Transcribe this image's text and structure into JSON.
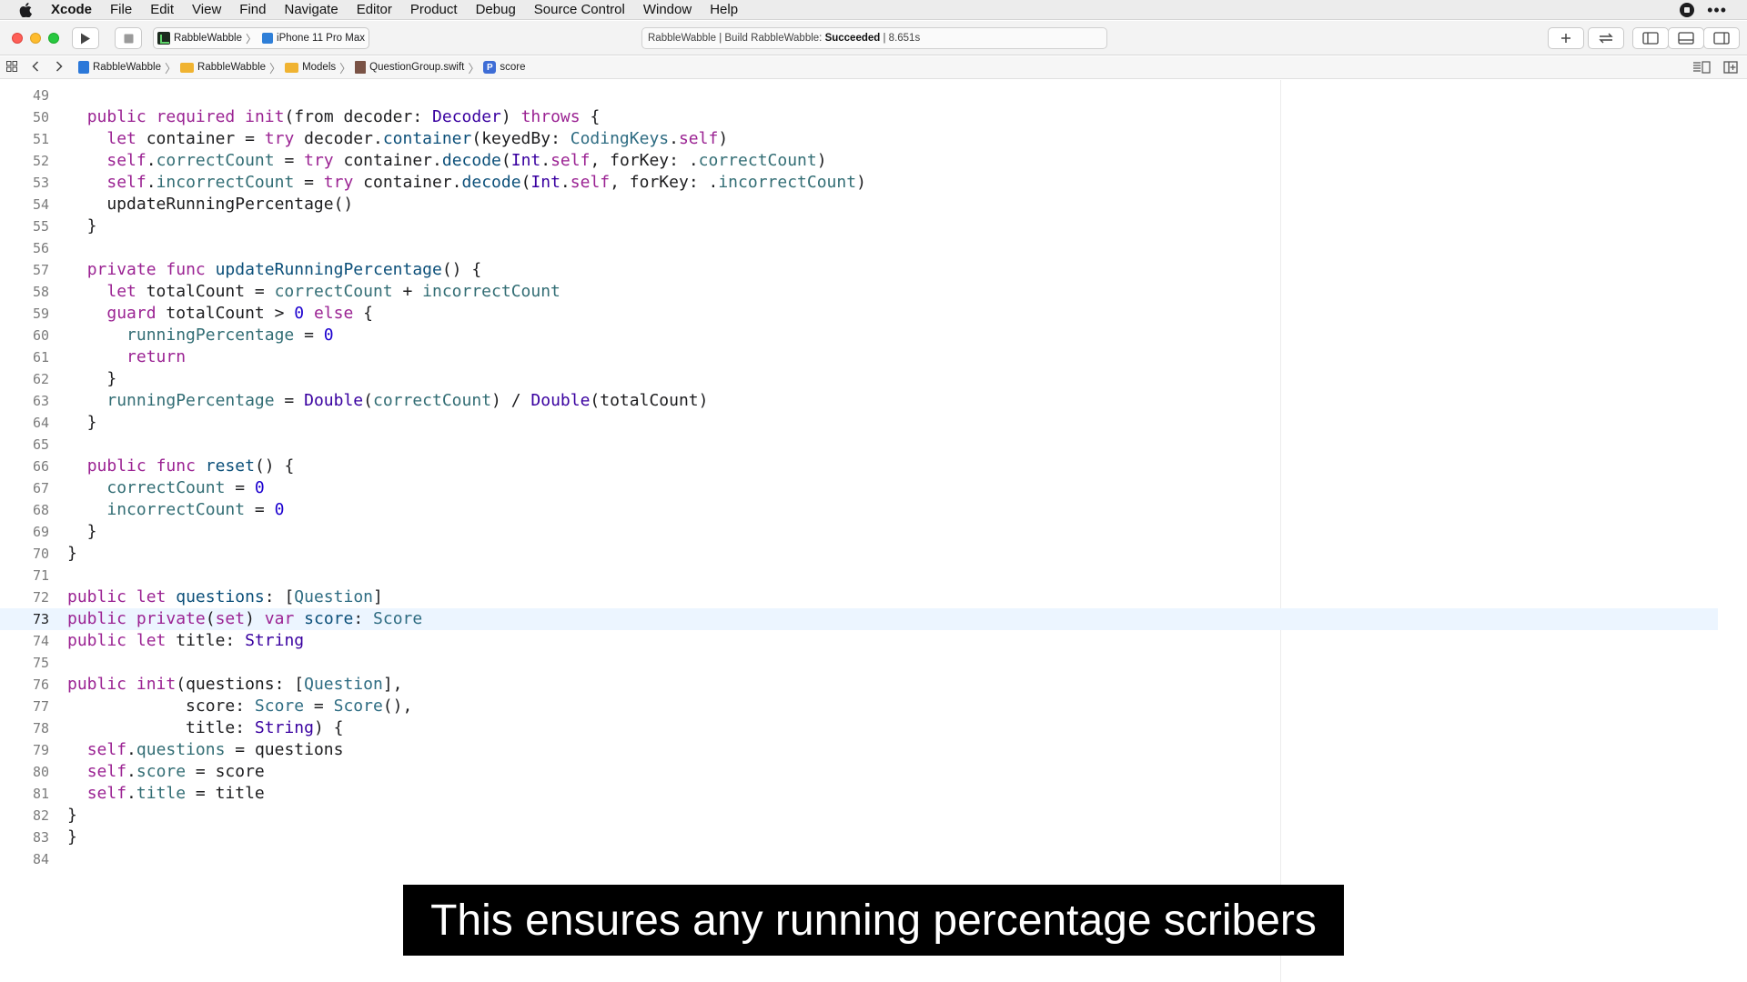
{
  "menubar": {
    "app": "Xcode",
    "items": [
      "File",
      "Edit",
      "View",
      "Find",
      "Navigate",
      "Editor",
      "Product",
      "Debug",
      "Source Control",
      "Window",
      "Help"
    ],
    "more": "•••"
  },
  "toolbar": {
    "scheme": "RabbleWabble",
    "destination": "iPhone 11 Pro Max",
    "activity_prefix": "RabbleWabble | Build RabbleWabble: ",
    "activity_status": "Succeeded",
    "activity_time": " | 8.651s"
  },
  "jumpbar": {
    "crumbs": [
      "RabbleWabble",
      "RabbleWabble",
      "Models",
      "QuestionGroup.swift",
      "score"
    ],
    "symbol_badge": "P"
  },
  "editor": {
    "current_line": "73",
    "lines": [
      {
        "n": "49",
        "tokens": []
      },
      {
        "n": "50",
        "tokens": [
          [
            "  ",
            ""
          ],
          [
            "public",
            "kw"
          ],
          [
            " ",
            ""
          ],
          [
            "required",
            "kw"
          ],
          [
            " ",
            ""
          ],
          [
            "init",
            "kw"
          ],
          [
            "(from decoder: ",
            ""
          ],
          [
            "Decoder",
            "ty"
          ],
          [
            ") ",
            ""
          ],
          [
            "throws",
            "kw"
          ],
          [
            " {",
            ""
          ]
        ]
      },
      {
        "n": "51",
        "tokens": [
          [
            "    ",
            ""
          ],
          [
            "let",
            "kw"
          ],
          [
            " container = ",
            ""
          ],
          [
            "try",
            "kw"
          ],
          [
            " decoder.",
            ""
          ],
          [
            "container",
            "cl"
          ],
          [
            "(keyedBy: ",
            ""
          ],
          [
            "CodingKeys",
            "tp"
          ],
          [
            ".",
            ""
          ],
          [
            "self",
            "kw"
          ],
          [
            ")",
            ""
          ]
        ]
      },
      {
        "n": "52",
        "tokens": [
          [
            "    ",
            ""
          ],
          [
            "self",
            "kw"
          ],
          [
            ".",
            ""
          ],
          [
            "correctCount",
            "pr"
          ],
          [
            " = ",
            ""
          ],
          [
            "try",
            "kw"
          ],
          [
            " container.",
            ""
          ],
          [
            "decode",
            "cl"
          ],
          [
            "(",
            ""
          ],
          [
            "Int",
            "ty"
          ],
          [
            ".",
            ""
          ],
          [
            "self",
            "kw"
          ],
          [
            ", forKey: .",
            ""
          ],
          [
            "correctCount",
            "pr"
          ],
          [
            ")",
            ""
          ]
        ]
      },
      {
        "n": "53",
        "tokens": [
          [
            "    ",
            ""
          ],
          [
            "self",
            "kw"
          ],
          [
            ".",
            ""
          ],
          [
            "incorrectCount",
            "pr"
          ],
          [
            " = ",
            ""
          ],
          [
            "try",
            "kw"
          ],
          [
            " container.",
            ""
          ],
          [
            "decode",
            "cl"
          ],
          [
            "(",
            ""
          ],
          [
            "Int",
            "ty"
          ],
          [
            ".",
            ""
          ],
          [
            "self",
            "kw"
          ],
          [
            ", forKey: .",
            ""
          ],
          [
            "incorrectCount",
            "pr"
          ],
          [
            ")",
            ""
          ]
        ]
      },
      {
        "n": "54",
        "tokens": [
          [
            "    updateRunningPercentage()",
            ""
          ]
        ]
      },
      {
        "n": "55",
        "tokens": [
          [
            "  }",
            ""
          ]
        ]
      },
      {
        "n": "56",
        "tokens": []
      },
      {
        "n": "57",
        "tokens": [
          [
            "  ",
            ""
          ],
          [
            "private",
            "kw"
          ],
          [
            " ",
            ""
          ],
          [
            "func",
            "kw"
          ],
          [
            " ",
            ""
          ],
          [
            "updateRunningPercentage",
            "cl"
          ],
          [
            "() {",
            ""
          ]
        ]
      },
      {
        "n": "58",
        "tokens": [
          [
            "    ",
            ""
          ],
          [
            "let",
            "kw"
          ],
          [
            " totalCount = ",
            ""
          ],
          [
            "correctCount",
            "pr"
          ],
          [
            " + ",
            ""
          ],
          [
            "incorrectCount",
            "pr"
          ]
        ]
      },
      {
        "n": "59",
        "tokens": [
          [
            "    ",
            ""
          ],
          [
            "guard",
            "kw"
          ],
          [
            " totalCount > ",
            ""
          ],
          [
            "0",
            "nu"
          ],
          [
            " ",
            ""
          ],
          [
            "else",
            "kw"
          ],
          [
            " {",
            ""
          ]
        ]
      },
      {
        "n": "60",
        "tokens": [
          [
            "      ",
            ""
          ],
          [
            "runningPercentage",
            "pr"
          ],
          [
            " = ",
            ""
          ],
          [
            "0",
            "nu"
          ]
        ]
      },
      {
        "n": "61",
        "tokens": [
          [
            "      ",
            ""
          ],
          [
            "return",
            "kw"
          ]
        ]
      },
      {
        "n": "62",
        "tokens": [
          [
            "    }",
            ""
          ]
        ]
      },
      {
        "n": "63",
        "tokens": [
          [
            "    ",
            ""
          ],
          [
            "runningPercentage",
            "pr"
          ],
          [
            " = ",
            ""
          ],
          [
            "Double",
            "ty"
          ],
          [
            "(",
            ""
          ],
          [
            "correctCount",
            "pr"
          ],
          [
            ") / ",
            ""
          ],
          [
            "Double",
            "ty"
          ],
          [
            "(totalCount)",
            ""
          ]
        ]
      },
      {
        "n": "64",
        "tokens": [
          [
            "  }",
            ""
          ]
        ]
      },
      {
        "n": "65",
        "tokens": []
      },
      {
        "n": "66",
        "tokens": [
          [
            "  ",
            ""
          ],
          [
            "public",
            "kw"
          ],
          [
            " ",
            ""
          ],
          [
            "func",
            "kw"
          ],
          [
            " ",
            ""
          ],
          [
            "reset",
            "cl"
          ],
          [
            "() {",
            ""
          ]
        ]
      },
      {
        "n": "67",
        "tokens": [
          [
            "    ",
            ""
          ],
          [
            "correctCount",
            "pr"
          ],
          [
            " = ",
            ""
          ],
          [
            "0",
            "nu"
          ]
        ]
      },
      {
        "n": "68",
        "tokens": [
          [
            "    ",
            ""
          ],
          [
            "incorrectCount",
            "pr"
          ],
          [
            " = ",
            ""
          ],
          [
            "0",
            "nu"
          ]
        ]
      },
      {
        "n": "69",
        "tokens": [
          [
            "  }",
            ""
          ]
        ]
      },
      {
        "n": "70",
        "tokens": [
          [
            "}",
            ""
          ]
        ]
      },
      {
        "n": "71",
        "tokens": []
      },
      {
        "n": "72",
        "tokens": [
          [
            "public",
            "kw"
          ],
          [
            " ",
            ""
          ],
          [
            "let",
            "kw"
          ],
          [
            " ",
            ""
          ],
          [
            "questions",
            "cl"
          ],
          [
            ": [",
            ""
          ],
          [
            "Question",
            "tp"
          ],
          [
            "]",
            ""
          ]
        ]
      },
      {
        "n": "73",
        "tokens": [
          [
            "public",
            "kw"
          ],
          [
            " ",
            ""
          ],
          [
            "private",
            "kw"
          ],
          [
            "(",
            ""
          ],
          [
            "set",
            "kw"
          ],
          [
            ") ",
            ""
          ],
          [
            "var",
            "kw"
          ],
          [
            " ",
            ""
          ],
          [
            "score",
            "cl"
          ],
          [
            ": ",
            ""
          ],
          [
            "Score",
            "tp"
          ]
        ]
      },
      {
        "n": "74",
        "tokens": [
          [
            "public",
            "kw"
          ],
          [
            " ",
            ""
          ],
          [
            "let",
            "kw"
          ],
          [
            " title: ",
            ""
          ],
          [
            "String",
            "ty"
          ]
        ]
      },
      {
        "n": "75",
        "tokens": []
      },
      {
        "n": "76",
        "tokens": [
          [
            "public",
            "kw"
          ],
          [
            " ",
            ""
          ],
          [
            "init",
            "kw"
          ],
          [
            "(questions: [",
            ""
          ],
          [
            "Question",
            "tp"
          ],
          [
            "],",
            ""
          ]
        ]
      },
      {
        "n": "77",
        "tokens": [
          [
            "            score: ",
            ""
          ],
          [
            "Score",
            "tp"
          ],
          [
            " = ",
            ""
          ],
          [
            "Score",
            "tp"
          ],
          [
            "(),",
            ""
          ]
        ]
      },
      {
        "n": "78",
        "tokens": [
          [
            "            title: ",
            ""
          ],
          [
            "String",
            "ty"
          ],
          [
            ") {",
            ""
          ]
        ]
      },
      {
        "n": "79",
        "tokens": [
          [
            "  ",
            ""
          ],
          [
            "self",
            "kw"
          ],
          [
            ".",
            ""
          ],
          [
            "questions",
            "pr"
          ],
          [
            " = questions",
            ""
          ]
        ]
      },
      {
        "n": "80",
        "tokens": [
          [
            "  ",
            ""
          ],
          [
            "self",
            "kw"
          ],
          [
            ".",
            ""
          ],
          [
            "score",
            "pr"
          ],
          [
            " = score",
            ""
          ]
        ]
      },
      {
        "n": "81",
        "tokens": [
          [
            "  ",
            ""
          ],
          [
            "self",
            "kw"
          ],
          [
            ".",
            ""
          ],
          [
            "title",
            "pr"
          ],
          [
            " = title",
            ""
          ]
        ]
      },
      {
        "n": "82",
        "tokens": [
          [
            "}",
            ""
          ]
        ]
      },
      {
        "n": "83",
        "tokens": [
          [
            "}",
            ""
          ]
        ]
      },
      {
        "n": "84",
        "tokens": []
      }
    ]
  },
  "caption": "This ensures any running percentage scribers",
  "colors": {
    "keyword": "#9b2393",
    "type": "#3900a0",
    "number": "#1c00cf",
    "property": "#326d74",
    "current_line": "#ecf5ff"
  }
}
